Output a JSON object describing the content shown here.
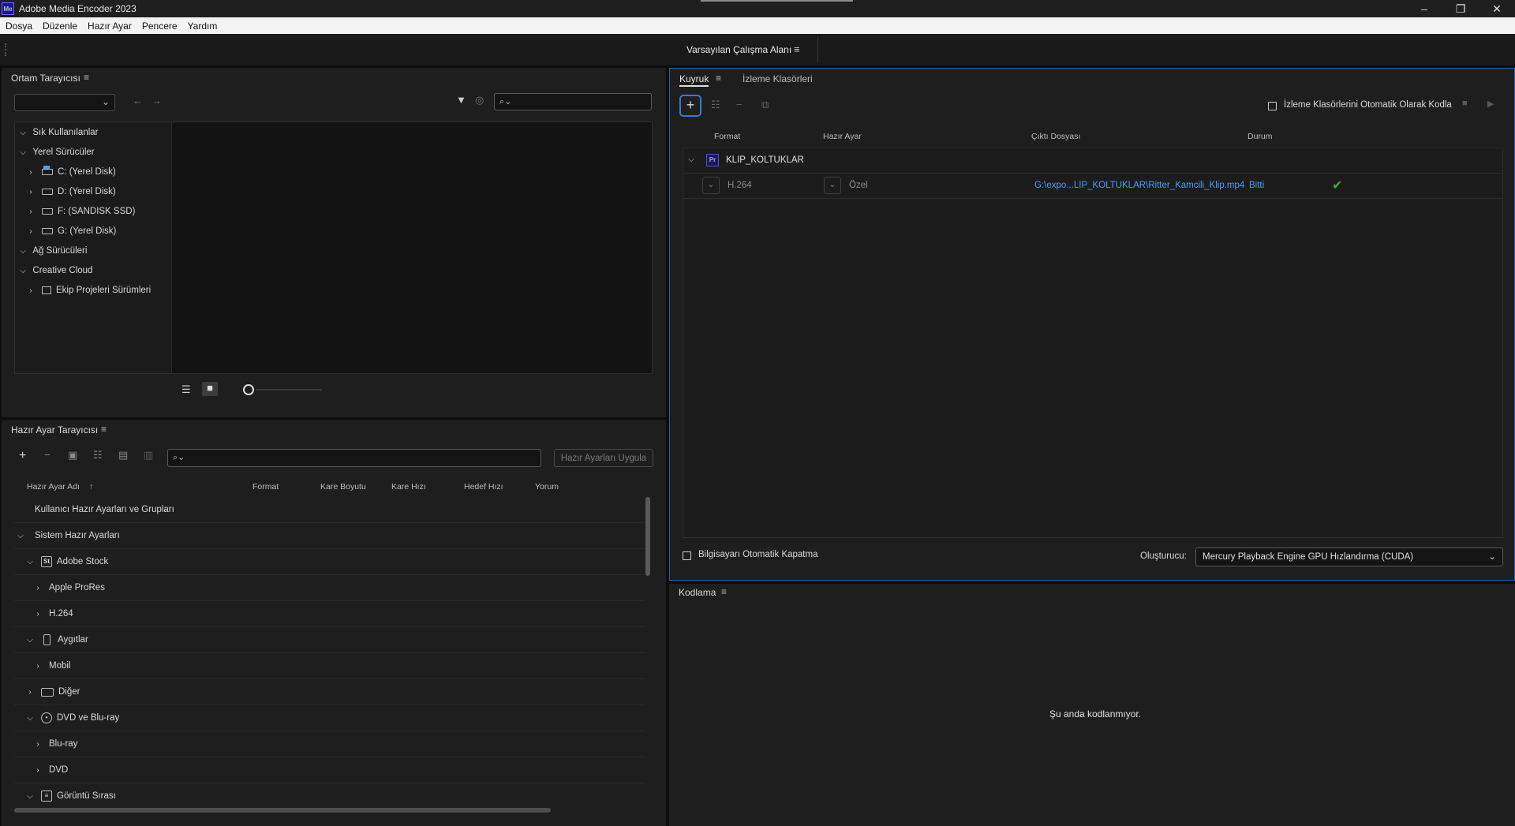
{
  "window": {
    "title": "Adobe Media Encoder 2023",
    "logo": "Me"
  },
  "menu": [
    "Dosya",
    "Düzenle",
    "Hazır Ayar",
    "Pencere",
    "Yardım"
  ],
  "workspace": {
    "label": "Varsayılan Çalışma Alanı"
  },
  "media_browser": {
    "title": "Ortam Tarayıcısı",
    "tree": {
      "favorites": "Sık Kullanılanlar",
      "local_drives": "Yerel Sürücüler",
      "drives": [
        "C: (Yerel Disk)",
        "D: (Yerel Disk)",
        "F: (SANDISK SSD)",
        "G: (Yerel Disk)"
      ],
      "network": "Ağ Sürücüleri",
      "creative_cloud": "Creative Cloud",
      "team_projects": "Ekip Projeleri Sürümleri"
    }
  },
  "preset_browser": {
    "title": "Hazır Ayar Tarayıcısı",
    "apply_label": "Hazır Ayarları Uygula",
    "columns": [
      "Hazır Ayar Adı",
      "Format",
      "Kare Boyutu",
      "Kare Hızı",
      "Hedef Hızı",
      "Yorum"
    ],
    "rows": {
      "user": "Kullanıcı Hazır Ayarları ve Grupları",
      "system": "Sistem Hazır Ayarları",
      "adobe_stock": "Adobe Stock",
      "prores": "Apple ProRes",
      "h264": "H.264",
      "devices": "Aygıtlar",
      "mobile": "Mobil",
      "other": "Diğer",
      "dvd_bluray": "DVD ve Blu-ray",
      "bluray": "Blu-ray",
      "dvd": "DVD",
      "image_sequence": "Görüntü Sırası"
    }
  },
  "queue": {
    "tab_queue": "Kuyruk",
    "tab_watch": "İzleme Klasörleri",
    "auto_encode_label": "İzleme Klasörlerini Otomatik Olarak Kodla",
    "columns": {
      "format": "Format",
      "preset": "Hazır Ayar",
      "output": "Çıktı Dosyası",
      "status": "Durum"
    },
    "group_name": "KLIP_KOLTUKLAR",
    "group_icon": "Pr",
    "item": {
      "format": "H.264",
      "preset": "Özel",
      "output": "G:\\expo...LIP_KOLTUKLAR\\Ritter_Kamcili_Klip.mp4",
      "status": "Bitti"
    },
    "shutdown_label": "Bilgisayarı Otomatik Kapatma",
    "renderer_label": "Oluşturucu:",
    "renderer_value": "Mercury Playback Engine GPU Hızlandırma (CUDA)"
  },
  "encoding": {
    "title": "Kodlama",
    "idle_message": "Şu anda kodlanmıyor."
  },
  "colors": {
    "accent": "#3a78d0",
    "link": "#4a9eff",
    "done_check": "#3fae3f"
  }
}
